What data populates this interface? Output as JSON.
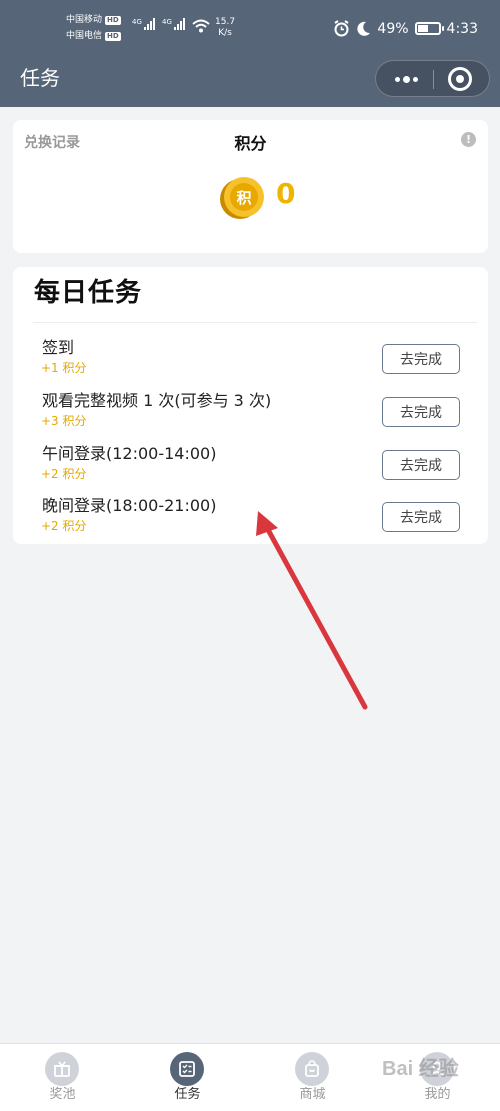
{
  "status_bar": {
    "carrier1": "中国移动",
    "carrier2": "中国电信",
    "hd_badge": "HD",
    "network1": "4G",
    "network2": "4G",
    "speed_value": "15.7",
    "speed_unit": "K/s",
    "battery_percent": "49%",
    "battery_level": 0.49,
    "time": "4:33"
  },
  "nav": {
    "title": "任务"
  },
  "points_card": {
    "exchange_link": "兑换记录",
    "title": "积分",
    "info_icon": "!",
    "coin_glyph": "积",
    "points": "0"
  },
  "daily_tasks": {
    "heading": "每日任务",
    "tasks": [
      {
        "name": "签到",
        "reward": "+1 积分",
        "button": "去完成"
      },
      {
        "name": "观看完整视频 1 次(可参与 3 次)",
        "reward": "+3 积分",
        "button": "去完成"
      },
      {
        "name": "午间登录(12:00-14:00)",
        "reward": "+2 积分",
        "button": "去完成"
      },
      {
        "name": "晚间登录(18:00-21:00)",
        "reward": "+2 积分",
        "button": "去完成"
      }
    ]
  },
  "tabbar": {
    "tabs": [
      {
        "label": "奖池",
        "icon": "prize-pool-icon",
        "active": false
      },
      {
        "label": "任务",
        "icon": "task-list-icon",
        "active": true
      },
      {
        "label": "商城",
        "icon": "shopping-bag-icon",
        "active": false
      },
      {
        "label": "我的",
        "icon": "profile-icon",
        "active": false
      }
    ]
  },
  "watermark": "Bai 经验",
  "colors": {
    "header_bg": "#566578",
    "page_bg": "#f2f3f5",
    "accent_gold": "#f0b400",
    "reward_text": "#e5a800",
    "annotation_arrow": "#d9363e"
  }
}
